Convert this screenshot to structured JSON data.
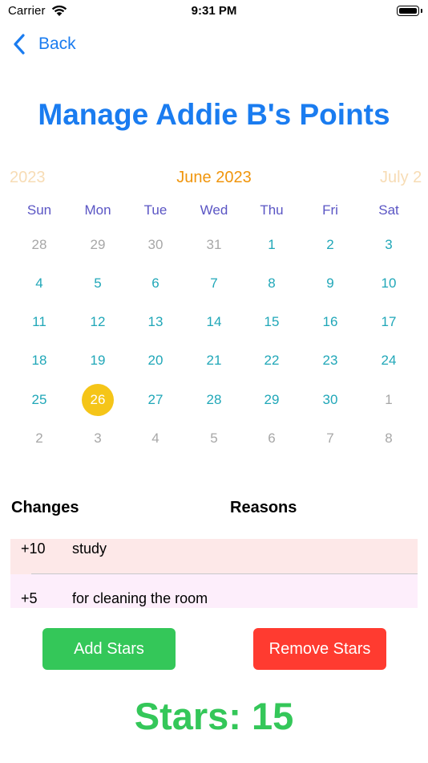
{
  "status_bar": {
    "carrier": "Carrier",
    "time": "9:31 PM"
  },
  "nav": {
    "back_label": "Back"
  },
  "title": "Manage Addie B's Points",
  "calendar": {
    "prev_month": "2023",
    "current_month": "June 2023",
    "next_month": "July 2",
    "weekdays": [
      "Sun",
      "Mon",
      "Tue",
      "Wed",
      "Thu",
      "Fri",
      "Sat"
    ],
    "selected_day": "26",
    "weeks": [
      [
        [
          "28",
          "other"
        ],
        [
          "29",
          "other"
        ],
        [
          "30",
          "other"
        ],
        [
          "31",
          "other"
        ],
        [
          "1",
          "cur"
        ],
        [
          "2",
          "cur"
        ],
        [
          "3",
          "cur"
        ]
      ],
      [
        [
          "4",
          "cur"
        ],
        [
          "5",
          "cur"
        ],
        [
          "6",
          "cur"
        ],
        [
          "7",
          "cur"
        ],
        [
          "8",
          "cur"
        ],
        [
          "9",
          "cur"
        ],
        [
          "10",
          "cur"
        ]
      ],
      [
        [
          "11",
          "cur"
        ],
        [
          "12",
          "cur"
        ],
        [
          "13",
          "cur"
        ],
        [
          "14",
          "cur"
        ],
        [
          "15",
          "cur"
        ],
        [
          "16",
          "cur"
        ],
        [
          "17",
          "cur"
        ]
      ],
      [
        [
          "18",
          "cur"
        ],
        [
          "19",
          "cur"
        ],
        [
          "20",
          "cur"
        ],
        [
          "21",
          "cur"
        ],
        [
          "22",
          "cur"
        ],
        [
          "23",
          "cur"
        ],
        [
          "24",
          "cur"
        ]
      ],
      [
        [
          "25",
          "cur"
        ],
        [
          "26",
          "sel"
        ],
        [
          "27",
          "cur"
        ],
        [
          "28",
          "cur"
        ],
        [
          "29",
          "cur"
        ],
        [
          "30",
          "cur"
        ],
        [
          "1",
          "other"
        ]
      ],
      [
        [
          "2",
          "other"
        ],
        [
          "3",
          "other"
        ],
        [
          "4",
          "other"
        ],
        [
          "5",
          "other"
        ],
        [
          "6",
          "other"
        ],
        [
          "7",
          "other"
        ],
        [
          "8",
          "other"
        ]
      ]
    ]
  },
  "table": {
    "headers": {
      "changes": "Changes",
      "reasons": "Reasons"
    },
    "rows": [
      {
        "change": "+10",
        "reason": "study",
        "bg": "#fde8e8"
      },
      {
        "change": "+5",
        "reason": "for cleaning the room",
        "bg": "#fdeefb"
      }
    ]
  },
  "buttons": {
    "add": "Add Stars",
    "remove": "Remove Stars"
  },
  "stars_label": "Stars: 15",
  "colors": {
    "accent_blue": "#1a7cf0",
    "add_green": "#34c759",
    "remove_red": "#ff3b30",
    "month_orange": "#f0950c",
    "weekday_purple": "#5a55c4",
    "day_teal": "#20a7b8",
    "selected_yellow": "#f5c518"
  }
}
